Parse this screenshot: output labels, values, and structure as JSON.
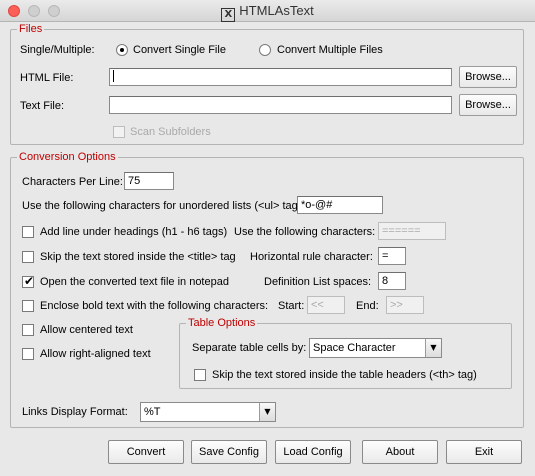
{
  "window": {
    "title": "HTMLAsText",
    "icon_glyph": "X"
  },
  "files": {
    "legend": "Files",
    "mode_label": "Single/Multiple:",
    "single_label": "Convert Single File",
    "multiple_label": "Convert Multiple Files",
    "mode_selected": "single",
    "html_file_label": "HTML File:",
    "html_file_value": "",
    "text_file_label": "Text File:",
    "text_file_value": "",
    "browse_label": "Browse...",
    "scan_subfolders_label": "Scan Subfolders",
    "scan_subfolders_checked": false
  },
  "conversion": {
    "legend": "Conversion Options",
    "chars_per_line_label": "Characters Per Line:",
    "chars_per_line_value": "75",
    "ul_chars_label": "Use the following characters for unordered lists (<ul> tag):",
    "ul_chars_value": "*o-@#",
    "add_line_label": "Add line under headings (h1 - h6 tags)",
    "add_line_checked": false,
    "use_chars_label": "Use the following characters:",
    "use_chars_value": "======",
    "skip_title_label": "Skip the text stored inside the <title> tag",
    "skip_title_checked": false,
    "hr_char_label": "Horizontal rule character:",
    "hr_char_value": "=",
    "open_notepad_label": "Open the converted text file in notepad",
    "open_notepad_checked": true,
    "dl_spaces_label": "Definition List spaces:",
    "dl_spaces_value": "8",
    "enclose_bold_label": "Enclose bold text with the following characters:",
    "enclose_bold_checked": false,
    "start_label": "Start:",
    "start_value": "<<",
    "end_label": "End:",
    "end_value": ">>",
    "centered_label": "Allow centered text",
    "centered_checked": false,
    "right_aligned_label": "Allow right-aligned text",
    "right_aligned_checked": false,
    "links_label": "Links Display Format:",
    "links_value": "%T"
  },
  "table_options": {
    "legend": "Table Options",
    "separate_label": "Separate table cells by:",
    "separate_value": "Space Character",
    "skip_th_label": "Skip the text stored inside the table headers (<th> tag)",
    "skip_th_checked": false
  },
  "buttons": {
    "convert": "Convert",
    "save_config": "Save Config",
    "load_config": "Load Config",
    "about": "About",
    "exit": "Exit"
  },
  "colors": {
    "legend_red": "#c00000",
    "close_button": "#fc5f57"
  }
}
